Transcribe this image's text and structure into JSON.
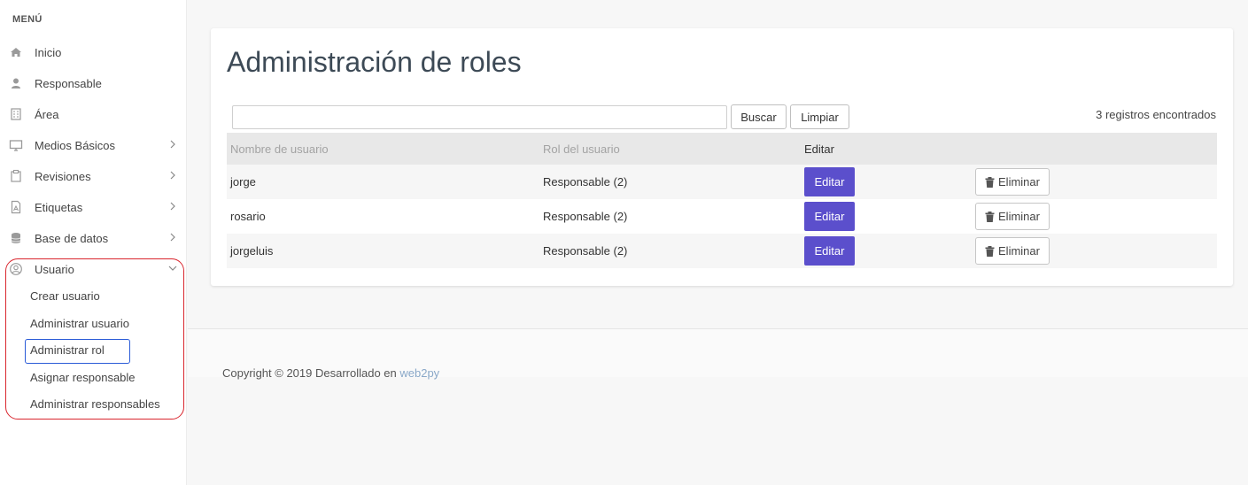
{
  "sidebar": {
    "heading": "MENÚ",
    "items": [
      {
        "label": "Inicio",
        "icon": "home-icon"
      },
      {
        "label": "Responsable",
        "icon": "user-icon"
      },
      {
        "label": "Área",
        "icon": "building-icon"
      },
      {
        "label": "Medios Básicos",
        "icon": "monitor-icon"
      },
      {
        "label": "Revisiones",
        "icon": "clipboard-icon"
      },
      {
        "label": "Etiquetas",
        "icon": "file-pdf-icon"
      },
      {
        "label": "Base de datos",
        "icon": "database-icon"
      },
      {
        "label": "Usuario",
        "icon": "user-circle-icon"
      }
    ],
    "usuario_submenu": [
      {
        "label": "Crear usuario"
      },
      {
        "label": "Administrar usuario"
      },
      {
        "label": "Administrar rol"
      },
      {
        "label": "Asignar responsable"
      },
      {
        "label": "Administrar responsables"
      }
    ]
  },
  "main": {
    "title": "Administración de roles",
    "search": {
      "value": "",
      "placeholder": ""
    },
    "search_button": "Buscar",
    "clear_button": "Limpiar",
    "records_count": "3 registros encontrados",
    "table": {
      "headers": [
        "Nombre de usuario",
        "Rol del usuario",
        "Editar"
      ],
      "rows": [
        {
          "username": "jorge",
          "role": "Responsable (2)",
          "edit": "Editar",
          "delete": "Eliminar"
        },
        {
          "username": "rosario",
          "role": "Responsable (2)",
          "edit": "Editar",
          "delete": "Eliminar"
        },
        {
          "username": "jorgeluis",
          "role": "Responsable (2)",
          "edit": "Editar",
          "delete": "Eliminar"
        }
      ]
    }
  },
  "footer": {
    "text": "Copyright © 2019 Desarrollado en ",
    "link": "web2py"
  },
  "colors": {
    "accent": "#5b4fcc",
    "highlight_red": "#d9262e",
    "highlight_blue": "#2a5bd7",
    "link": "#8aa8c8"
  }
}
